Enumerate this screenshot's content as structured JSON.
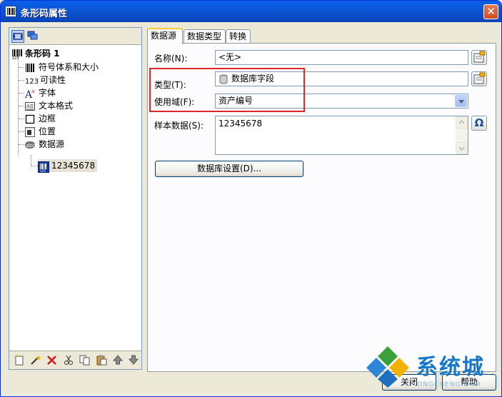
{
  "window": {
    "title": "条形码属性",
    "close_glyph": "✕"
  },
  "tree": {
    "root_label": "条形码 1",
    "items": [
      {
        "label": "符号体系和大小",
        "icon": "barcode-symbology-icon"
      },
      {
        "label": "可读性",
        "icon": "readable-123-icon",
        "prefix": "123"
      },
      {
        "label": "字体",
        "icon": "font-icon"
      },
      {
        "label": "文本格式",
        "icon": "text-format-icon"
      },
      {
        "label": "边框",
        "icon": "border-icon"
      },
      {
        "label": "位置",
        "icon": "position-icon"
      },
      {
        "label": "数据源",
        "icon": "data-source-icon"
      }
    ],
    "child": {
      "label": "12345678",
      "icon": "barcode-data-icon"
    }
  },
  "tabs": [
    {
      "label": "数据源",
      "active": true
    },
    {
      "label": "数据类型",
      "active": false
    },
    {
      "label": "转换",
      "active": false
    }
  ],
  "form": {
    "name_label": "名称(N):",
    "name_value": "<无>",
    "type_label": "类型(T):",
    "type_value": "数据库字段",
    "field_label": "使用域(F):",
    "field_value": "资产编号",
    "sample_label": "样本数据(S):",
    "sample_value": "12345678",
    "db_button": "数据库设置(D)...",
    "omega_glyph": "Ω"
  },
  "buttons": {
    "close": "关闭",
    "help": "帮助"
  },
  "watermark": {
    "text": "系统城",
    "sub": "XITONGCHENG.COM"
  },
  "colors": {
    "highlight_box": "#e0262a",
    "titlebar": "#0a5fe8",
    "tab_accent": "#ffc83c"
  }
}
